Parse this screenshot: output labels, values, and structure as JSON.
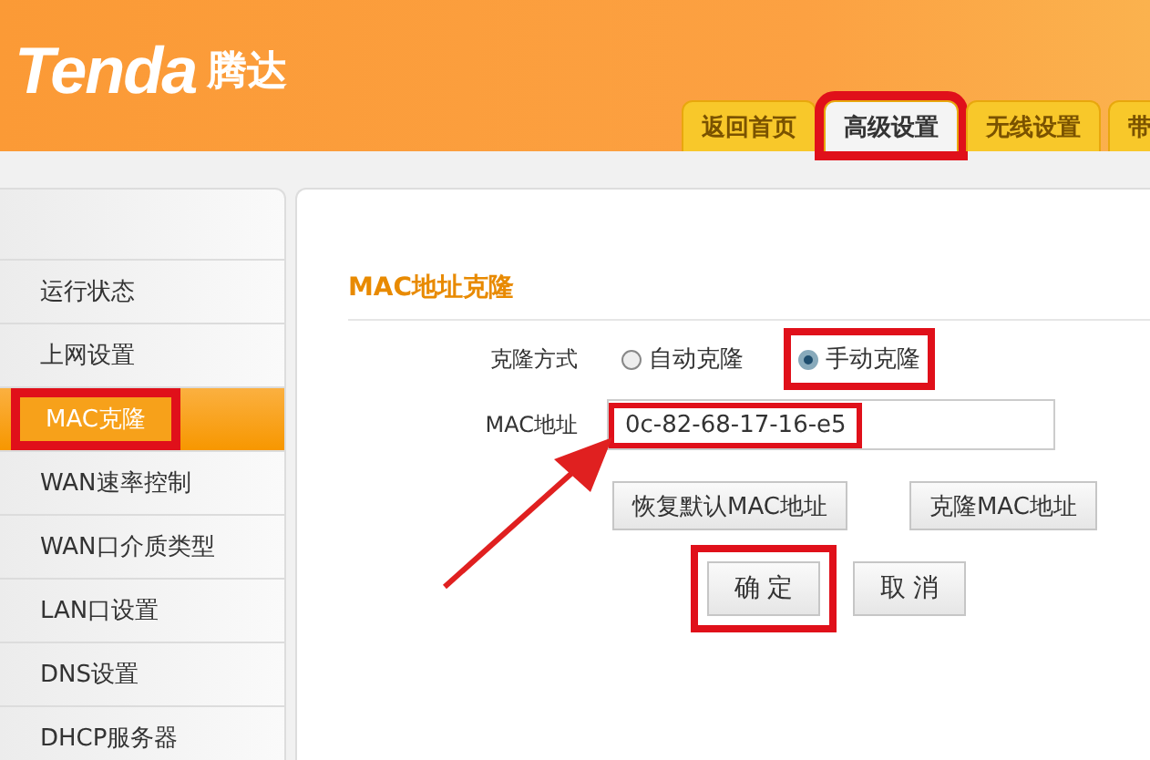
{
  "logo": {
    "brand": "Tenda",
    "suffix": "腾达"
  },
  "tabs": [
    {
      "label": "返回首页",
      "selected": false,
      "highlighted": false
    },
    {
      "label": "高级设置",
      "selected": true,
      "highlighted": true
    },
    {
      "label": "无线设置",
      "selected": false,
      "highlighted": false
    },
    {
      "label": "带",
      "selected": false,
      "highlighted": false
    }
  ],
  "sidebar": {
    "items": [
      {
        "label": "运行状态",
        "selected": false,
        "highlighted": false
      },
      {
        "label": "上网设置",
        "selected": false,
        "highlighted": false
      },
      {
        "label": "MAC克隆",
        "selected": true,
        "highlighted": true
      },
      {
        "label": "WAN速率控制",
        "selected": false,
        "highlighted": false
      },
      {
        "label": "WAN口介质类型",
        "selected": false,
        "highlighted": false
      },
      {
        "label": "LAN口设置",
        "selected": false,
        "highlighted": false
      },
      {
        "label": "DNS设置",
        "selected": false,
        "highlighted": false
      },
      {
        "label": "DHCP服务器",
        "selected": false,
        "highlighted": false
      }
    ]
  },
  "panel": {
    "title": "MAC地址克隆",
    "clone_mode": {
      "label": "克隆方式",
      "options": [
        {
          "label": "自动克隆",
          "selected": false,
          "highlighted": false
        },
        {
          "label": "手动克隆",
          "selected": true,
          "highlighted": true
        }
      ]
    },
    "mac": {
      "label": "MAC地址",
      "value": "0c-82-68-17-16-e5",
      "highlighted": true
    },
    "buttons": [
      {
        "label": "恢复默认MAC地址"
      },
      {
        "label": "克隆MAC地址"
      }
    ],
    "actions": [
      {
        "label": "确 定",
        "highlighted": true
      },
      {
        "label": "取 消",
        "highlighted": false
      }
    ]
  }
}
